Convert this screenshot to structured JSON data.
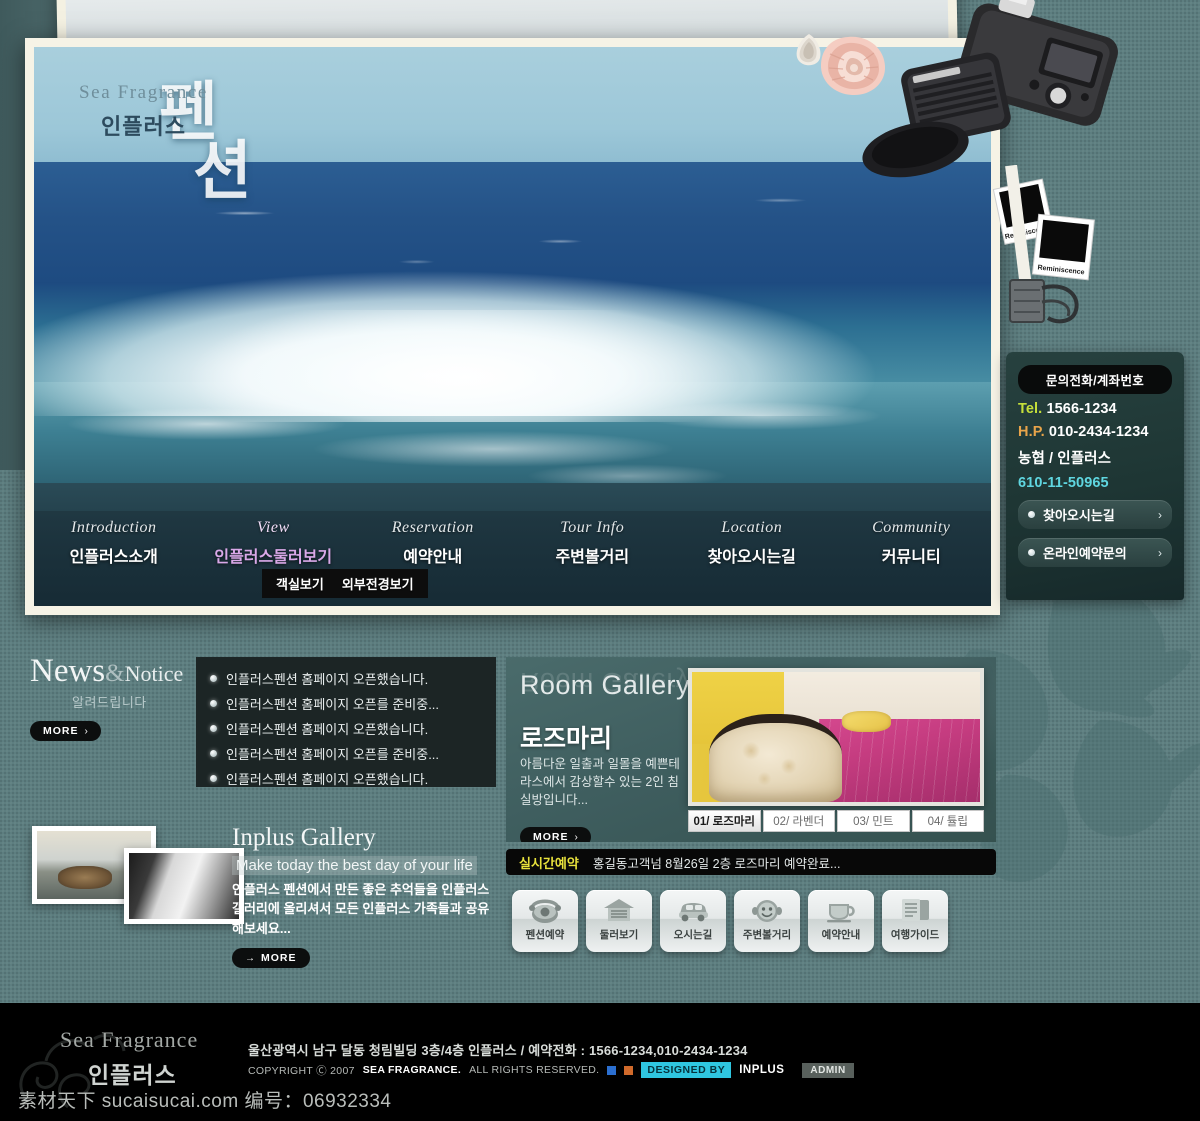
{
  "site": {
    "brand_en": "Sea Fragrance",
    "brand_kr": "인플러스",
    "hero_big_line1": "펜",
    "hero_big_line2": "션"
  },
  "nav": {
    "items": [
      {
        "en": "Introduction",
        "kr": "인플러스소개",
        "active": false
      },
      {
        "en": "View",
        "kr": "인플러스둘러보기",
        "active": true
      },
      {
        "en": "Reservation",
        "kr": "예약안내",
        "active": false
      },
      {
        "en": "Tour Info",
        "kr": "주변볼거리",
        "active": false
      },
      {
        "en": "Location",
        "kr": "찾아오시는길",
        "active": false
      },
      {
        "en": "Community",
        "kr": "커뮤니티",
        "active": false
      }
    ],
    "submenu": [
      "객실보기",
      "외부전경보기"
    ]
  },
  "contact": {
    "title": "문의전화/계좌번호",
    "tel_label": "Tel.",
    "tel_value": "1566-1234",
    "hp_label": "H.P.",
    "hp_value": "010-2434-1234",
    "bank": "농협 / 인플러스",
    "account": "610-11-50965",
    "buttons": [
      {
        "label": "찾아오시는길",
        "arrow": "›"
      },
      {
        "label": "온라인예약문의",
        "arrow": "›"
      }
    ]
  },
  "news": {
    "title_news": "News",
    "title_amp": "&",
    "title_notice": "Notice",
    "subtitle": "알려드립니다",
    "more_label": "MORE",
    "more_arrow": "›",
    "items": [
      "인플러스펜션 홈페이지 오픈했습니다.",
      "인플러스펜션 홈페이지 오픈를 준비중...",
      "인플러스펜션 홈페이지 오픈했습니다.",
      "인플러스펜션 홈페이지 오픈를 준비중...",
      "인플러스펜션 홈페이지 오픈했습니다."
    ]
  },
  "room_gallery": {
    "title": "Room Gallery",
    "room_name": "로즈마리",
    "description": "아름다운 일출과 일몰을 예쁜테라스에서 감상할수 있는 2인 침실방입니다...",
    "more_label": "MORE",
    "more_arrow": "›",
    "tabs": [
      {
        "label": "01/ 로즈마리",
        "active": true
      },
      {
        "label": "02/ 라벤더",
        "active": false
      },
      {
        "label": "03/ 민트",
        "active": false
      },
      {
        "label": "04/ 튤립",
        "active": false
      }
    ]
  },
  "inplus_gallery": {
    "title": "Inplus Gallery",
    "subtitle": "Make today the best day of your life",
    "description": "인플러스 펜션에서 만든 좋은 추억들을 인플러스 갤러리에 올리셔서 모든 인플러스 가족들과 공유해보세요...",
    "more_label": "MORE",
    "more_arrow": "→"
  },
  "realtime": {
    "label": "실시간예약",
    "message": "홍길동고객넘 8월26일 2층 로즈마리 예약완료..."
  },
  "quick_links": [
    {
      "label": "펜션예약",
      "icon": "telephone-icon"
    },
    {
      "label": "둘러보기",
      "icon": "house-icon"
    },
    {
      "label": "오시는길",
      "icon": "car-icon"
    },
    {
      "label": "주변볼거리",
      "icon": "smiley-face-icon"
    },
    {
      "label": "예약안내",
      "icon": "coffee-cup-icon"
    },
    {
      "label": "여행가이드",
      "icon": "document-folder-icon"
    }
  ],
  "footer": {
    "logo_en": "Sea Fragrance",
    "logo_kr": "인플러스",
    "address": "울산광역시 남구 달동 청림빌딩 3층/4층 인플러스 / 예약전화 : 1566-1234,010-2434-1234",
    "copyright_pre": "COPYRIGHT Ⓒ 2007",
    "copyright_brand": "SEA FRAGRANCE.",
    "copyright_post": "ALL RIGHTS RESERVED.",
    "designed_by": "DESIGNED BY",
    "designer": "INPLUS",
    "admin": "ADMIN"
  },
  "watermark": "素材天下 sucaisucai.com  编号：06932334",
  "colors": {
    "bg_teal": "#5d7e80",
    "frame_cream": "#f6f3e6",
    "accent_violet": "#d9a8e8",
    "tel_green": "#c5e03a",
    "hp_orange": "#e8a44a",
    "account_cyan": "#5fd6e0",
    "realtime_yellow": "#e8e23c",
    "designed_cyan": "#2fc6e0"
  }
}
